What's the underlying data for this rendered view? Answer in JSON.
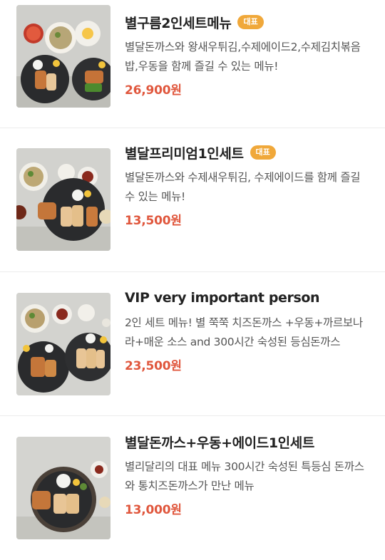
{
  "menu": {
    "items": [
      {
        "name": "별구름2인세트메뉴",
        "badge": "대표",
        "description": "별달돈까스와 왕새우튀김,수제에이드2,수제김치볶음밥,우동을 함께 즐길 수 있는 메뉴!",
        "price": "26,900원",
        "image_icon": "food-photo-icon"
      },
      {
        "name": "별달프리미엄1인세트",
        "badge": "대표",
        "description": "별달돈까스와 수제새우튀김, 수제에이드를 함께 즐길 수 있는 메뉴!",
        "price": "13,500원",
        "image_icon": "food-photo-icon"
      },
      {
        "name": "VIP very important person",
        "badge": "",
        "description": "2인 세트 메뉴! 별 쭉쭉 치즈돈까스 +우동+까르보나라+매운 소스 and 300시간 숙성된 등심돈까스",
        "price": "23,500원",
        "image_icon": "food-photo-icon"
      },
      {
        "name": "별달돈까스+우동+에이드1인세트",
        "badge": "",
        "description": "별리달리의 대표 메뉴 300시간 숙성된 특등심 돈까스와 통치즈돈까스가 만난 메뉴",
        "price": "13,000원",
        "image_icon": "food-photo-icon"
      }
    ],
    "colors": {
      "price": "#e0573d",
      "badge": "#f0a83a",
      "divider": "#ececec"
    }
  }
}
